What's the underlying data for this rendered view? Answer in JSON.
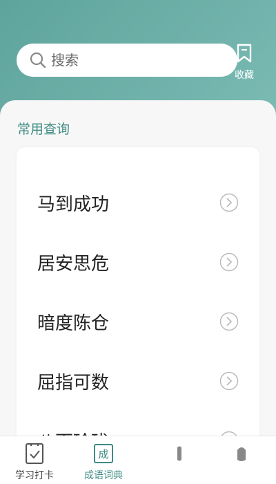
{
  "search": {
    "placeholder": "搜索"
  },
  "favorites": {
    "label": "收藏"
  },
  "section": {
    "title": "常用查询"
  },
  "idioms": [
    {
      "label": "马到成功"
    },
    {
      "label": "居安思危"
    },
    {
      "label": "暗度陈仓"
    },
    {
      "label": "屈指可数"
    },
    {
      "label": "八面玲珑"
    }
  ],
  "tabs": [
    {
      "label": "学习打卡",
      "active": false
    },
    {
      "label": "成语词典",
      "active": true,
      "icon_text": "成"
    },
    {
      "label": "",
      "active": false
    },
    {
      "label": "",
      "active": false
    }
  ],
  "colors": {
    "accent": "#3e8b83",
    "header": "#6fb3ab"
  }
}
